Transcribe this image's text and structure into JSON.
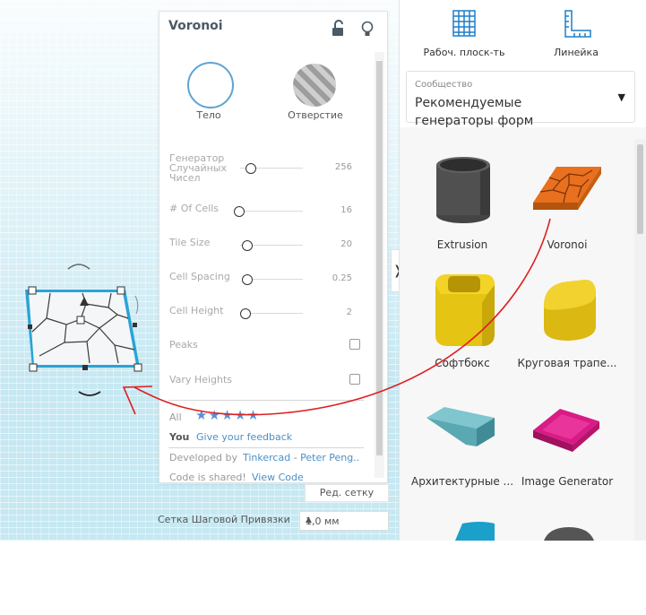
{
  "workplane": {
    "background": "#c6e8f2",
    "shape_color": "#2aa3d6"
  },
  "panel": {
    "title": "Voronoi",
    "lock_icon": "lock-icon",
    "bulb_icon": "lightbulb-icon",
    "solid_label": "Тело",
    "hole_label": "Отверстие",
    "params": [
      {
        "label": "Генератор Случайных Чисел",
        "value": "256",
        "fraction": 0.16
      },
      {
        "label": "# Of Cells",
        "value": "16",
        "fraction": 0.05
      },
      {
        "label": "Tile Size",
        "value": "20",
        "fraction": 0.1
      },
      {
        "label": "Cell Spacing",
        "value": "0.25",
        "fraction": 0.04
      },
      {
        "label": "Cell Height",
        "value": "2",
        "fraction": 0.03
      }
    ],
    "checks": [
      {
        "label": "Peaks",
        "checked": false
      },
      {
        "label": "Vary Heights",
        "checked": false
      }
    ],
    "rating_label": "All",
    "rating_stars": "★★★★★",
    "you_label": "You",
    "feedback_link": "Give your feedback",
    "developed_label": "Developed by",
    "developer_link": "Tinkercad - Peter Peng..",
    "code_label": "Code is shared!",
    "code_link": "View Code"
  },
  "grid_edit": "Ред. сетку",
  "snap": {
    "label": "Сетка Шаговой Привязки",
    "value": "1,0 мм"
  },
  "right": {
    "workplane_label": "Рабоч. плоск-ть",
    "ruler_label": "Линейка",
    "library_small": "Сообщество",
    "library_name": "Рекомендуемые генераторы форм",
    "items": [
      {
        "label": "Extrusion"
      },
      {
        "label": "Voronoi"
      },
      {
        "label": "Софтбокс"
      },
      {
        "label": "Круговая трапе..."
      },
      {
        "label": "Архитектурные ..."
      },
      {
        "label": "Image Generator"
      }
    ]
  },
  "colors": {
    "accent": "#4a90c8",
    "arrow": "#e02020",
    "star": "#5a8fd8"
  }
}
